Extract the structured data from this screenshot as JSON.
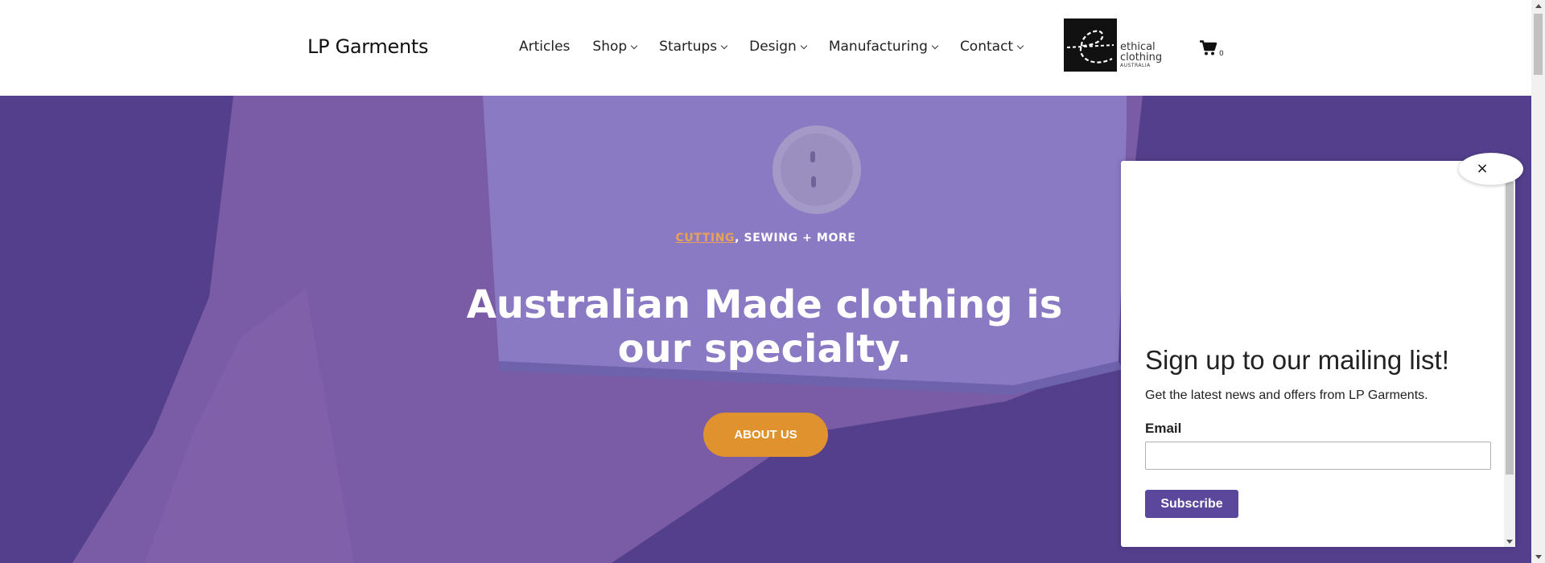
{
  "header": {
    "brand": "LP Garments",
    "nav": [
      {
        "label": "Articles",
        "dropdown": false
      },
      {
        "label": "Shop",
        "dropdown": true
      },
      {
        "label": "Startups",
        "dropdown": true
      },
      {
        "label": "Design",
        "dropdown": true
      },
      {
        "label": "Manufacturing",
        "dropdown": true
      },
      {
        "label": "Contact",
        "dropdown": true
      }
    ],
    "partner_logo": {
      "line1": "ethical",
      "line2": "clothing",
      "line3": "AUSTRALIA"
    },
    "cart": {
      "icon": "shopping-cart-icon",
      "count": "0"
    }
  },
  "hero": {
    "kicker_link": "CUTTING",
    "kicker_rest": ", SEWING + MORE",
    "title": "Australian Made clothing is our specialty.",
    "button_label": "ABOUT US"
  },
  "popup": {
    "close_symbol": "×",
    "title": "Sign up to our mailing list!",
    "subtitle": "Get the latest news and offers from LP Garments.",
    "email_label": "Email",
    "email_value": "",
    "submit_label": "Subscribe"
  },
  "colors": {
    "hero_purple": "#5a4596",
    "accent_orange": "#e0922f",
    "kicker_orange": "#e9a15a",
    "subscribe_purple": "#5b479c"
  }
}
